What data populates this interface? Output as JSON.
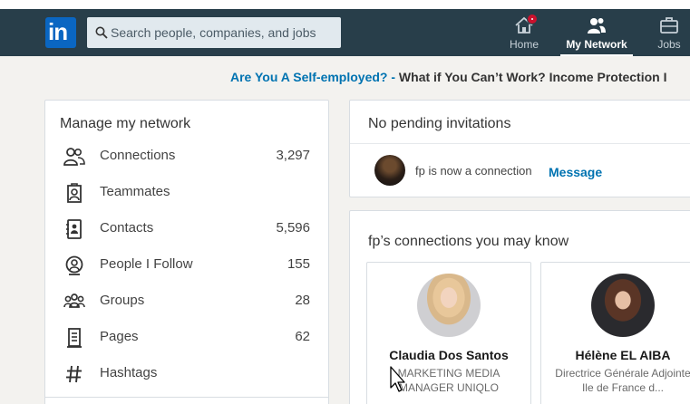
{
  "nav": {
    "search_placeholder": "Search people, companies, and jobs",
    "items": [
      {
        "label": "Home",
        "icon": "home-icon",
        "badge": true
      },
      {
        "label": "My Network",
        "icon": "people-icon",
        "active": true
      },
      {
        "label": "Jobs",
        "icon": "briefcase-icon"
      }
    ]
  },
  "promo": {
    "link": "Are You A Self-employed? -",
    "text": "What if You Can’t Work? Income Protection I"
  },
  "manage": {
    "title": "Manage my network",
    "items": [
      {
        "label": "Connections",
        "count": "3,297",
        "icon": "connections-icon"
      },
      {
        "label": "Teammates",
        "count": "",
        "icon": "teammates-icon"
      },
      {
        "label": "Contacts",
        "count": "5,596",
        "icon": "contacts-icon"
      },
      {
        "label": "People I Follow",
        "count": "155",
        "icon": "follow-icon"
      },
      {
        "label": "Groups",
        "count": "28",
        "icon": "groups-icon"
      },
      {
        "label": "Pages",
        "count": "62",
        "icon": "pages-icon"
      },
      {
        "label": "Hashtags",
        "count": "",
        "icon": "hashtag-icon"
      }
    ]
  },
  "invitations": {
    "title": "No pending invitations",
    "notice": "fp is now a connection",
    "action": "Message"
  },
  "pymk": {
    "title": "fp’s connections you may know",
    "people": [
      {
        "name": "Claudia Dos Santos",
        "occupation": "MARKETING MEDIA MANAGER UNIQLO"
      },
      {
        "name": "Hélène EL AIBA",
        "occupation": "Directrice Générale Adjointe Ile de France d..."
      }
    ]
  },
  "colors": {
    "nav_bg": "#283e4a",
    "brand": "#0a66c2",
    "link": "#0073b1",
    "badge": "#cb112d"
  }
}
